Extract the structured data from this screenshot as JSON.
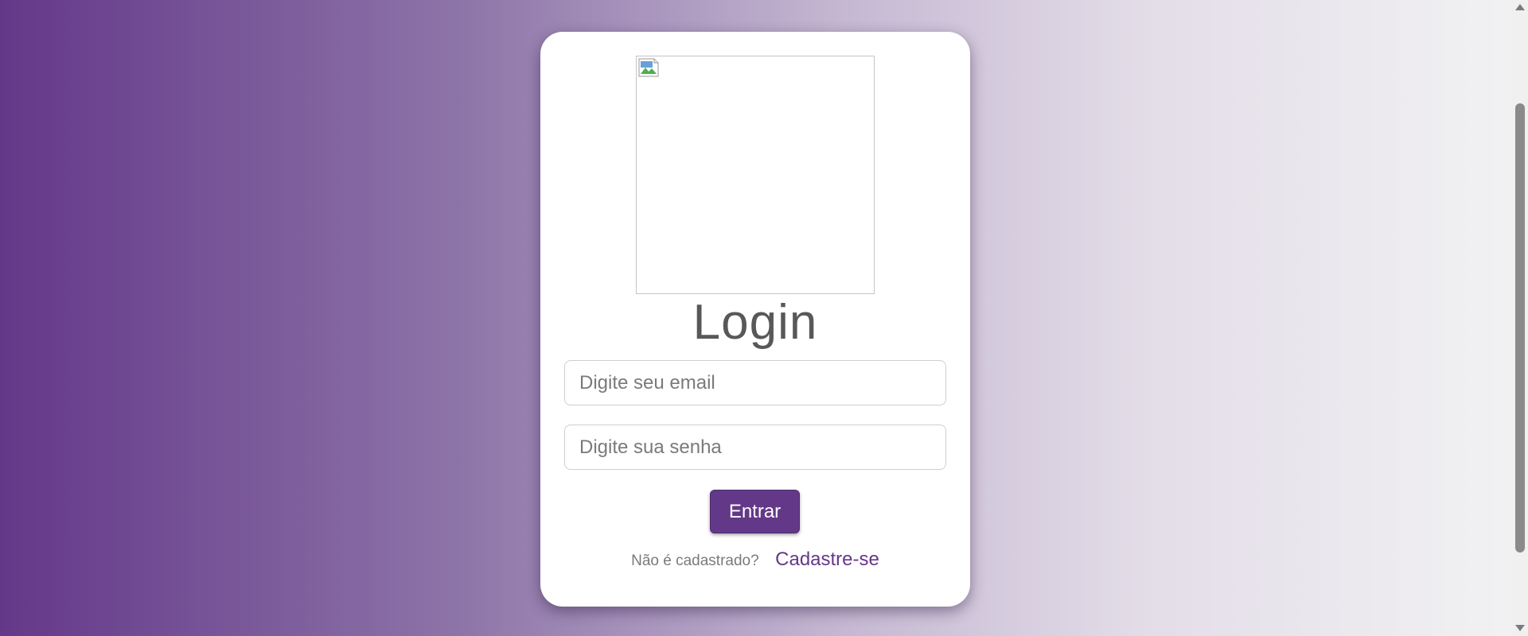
{
  "login": {
    "logo_alt": "",
    "title": "Login",
    "email": {
      "placeholder": "Digite seu email",
      "value": ""
    },
    "password": {
      "placeholder": "Digite sua senha",
      "value": ""
    },
    "submit_label": "Entrar",
    "register_prompt": "Não é cadastrado?",
    "register_link": "Cadastre-se"
  },
  "colors": {
    "accent": "#643889",
    "title": "#585858",
    "muted_text": "#7a7a7a"
  },
  "icons": {
    "logo": "broken-image-icon"
  }
}
